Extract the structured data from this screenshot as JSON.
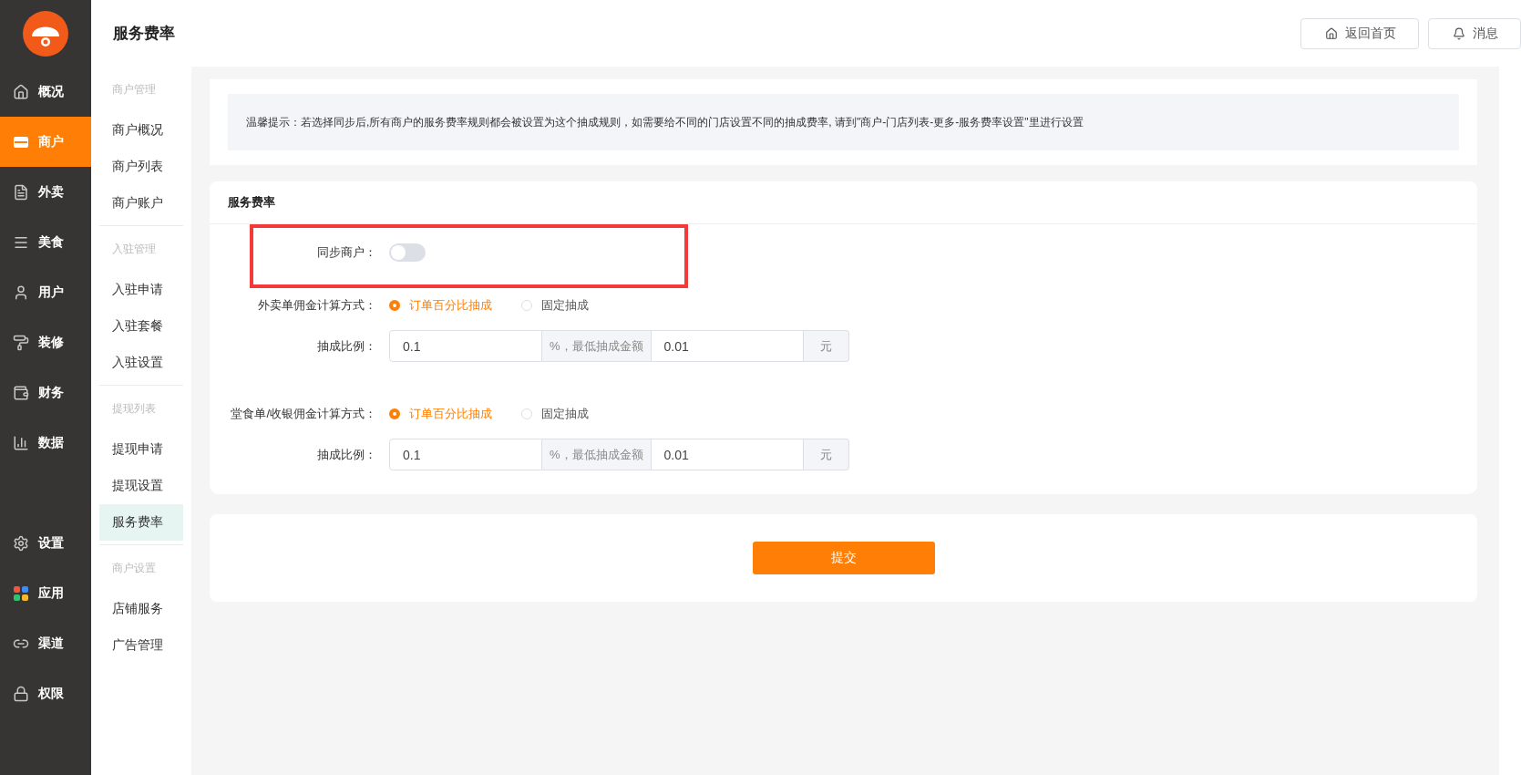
{
  "sidebar": {
    "main_items": [
      {
        "label": "概况",
        "selected": false
      },
      {
        "label": "商户",
        "selected": true
      },
      {
        "label": "外卖",
        "selected": false
      },
      {
        "label": "美食",
        "selected": false
      },
      {
        "label": "用户",
        "selected": false
      },
      {
        "label": "装修",
        "selected": false
      },
      {
        "label": "财务",
        "selected": false
      },
      {
        "label": "数据",
        "selected": false
      }
    ],
    "bottom_items": [
      {
        "label": "设置",
        "selected": false
      },
      {
        "label": "应用",
        "selected": false
      },
      {
        "label": "渠道",
        "selected": false
      },
      {
        "label": "权限",
        "selected": false
      }
    ]
  },
  "page_title": "服务费率",
  "header_buttons": [
    {
      "label": "返回首页",
      "kind": "home"
    },
    {
      "label": "消息",
      "kind": "bell"
    }
  ],
  "sub_nav": [
    {
      "title": "商户管理",
      "items": [
        {
          "label": "商户概况",
          "selected": false
        },
        {
          "label": "商户列表",
          "selected": false
        },
        {
          "label": "商户账户",
          "selected": false
        }
      ]
    },
    {
      "title": "入驻管理",
      "items": [
        {
          "label": "入驻申请",
          "selected": false
        },
        {
          "label": "入驻套餐",
          "selected": false
        },
        {
          "label": "入驻设置",
          "selected": false
        }
      ]
    },
    {
      "title": "提现列表",
      "items": [
        {
          "label": "提现申请",
          "selected": false
        },
        {
          "label": "提现设置",
          "selected": false
        },
        {
          "label": "服务费率",
          "selected": true
        }
      ]
    },
    {
      "title": "商户设置",
      "items": [
        {
          "label": "店铺服务",
          "selected": false
        },
        {
          "label": "广告管理",
          "selected": false
        }
      ]
    }
  ],
  "notice": "温馨提示：若选择同步后,所有商户的服务费率规则都会被设置为这个抽成规则，如需要给不同的门店设置不同的抽成费率, 请到\"商户-门店列表-更多-服务费率设置\"里进行设置",
  "section_title": "服务费率",
  "sync": {
    "label": "同步商户：",
    "on": false
  },
  "commission_groups": [
    {
      "label": "外卖单佣金计算方式：",
      "options": [
        {
          "label": "订单百分比抽成",
          "selected": true
        },
        {
          "label": "固定抽成",
          "selected": false
        }
      ],
      "rate_label": "抽成比例：",
      "rate_value": "0.1",
      "middle_addon": "%，最低抽成金额",
      "min_value": "0.01",
      "suffix": "元"
    },
    {
      "label": "堂食单/收银佣金计算方式：",
      "options": [
        {
          "label": "订单百分比抽成",
          "selected": true
        },
        {
          "label": "固定抽成",
          "selected": false
        }
      ],
      "rate_label": "抽成比例：",
      "rate_value": "0.1",
      "middle_addon": "%，最低抽成金额",
      "min_value": "0.01",
      "suffix": "元"
    }
  ],
  "submit": "提交"
}
